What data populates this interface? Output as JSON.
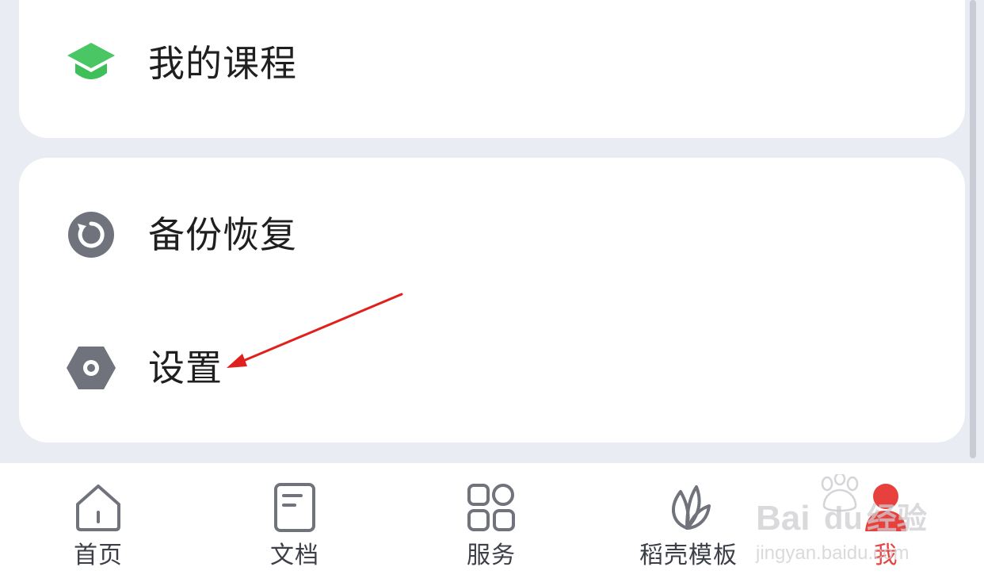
{
  "menu": {
    "courses_label": "我的课程",
    "backup_label": "备份恢复",
    "settings_label": "设置"
  },
  "tabs": [
    {
      "label": "首页",
      "icon": "home-icon",
      "active": false
    },
    {
      "label": "文档",
      "icon": "document-icon",
      "active": false
    },
    {
      "label": "服务",
      "icon": "grid-apps-icon",
      "active": false
    },
    {
      "label": "稻壳模板",
      "icon": "leaf-template-icon",
      "active": false
    },
    {
      "label": "我",
      "icon": "avatar-dot-icon",
      "active": true
    }
  ],
  "watermark": {
    "brand_prefix": "Bai",
    "brand_suffix": "du",
    "brand_tail": "经验",
    "url": "jingyan.baidu.com"
  },
  "colors": {
    "accent_green": "#3fbf5a",
    "icon_gray": "#70737c",
    "active_red": "#e8413d",
    "annotation_arrow": "#e0201c",
    "background": "#e9ecf3"
  }
}
